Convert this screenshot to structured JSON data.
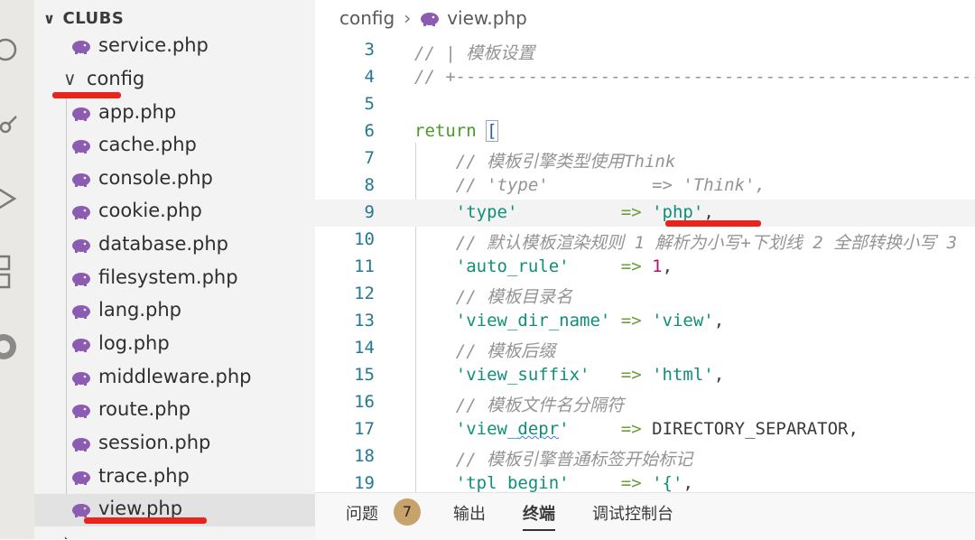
{
  "sidebar": {
    "header": "CLUBS",
    "items": [
      {
        "type": "file",
        "name": "service.php"
      },
      {
        "type": "folder",
        "name": "config"
      },
      {
        "type": "file",
        "name": "app.php"
      },
      {
        "type": "file",
        "name": "cache.php"
      },
      {
        "type": "file",
        "name": "console.php"
      },
      {
        "type": "file",
        "name": "cookie.php"
      },
      {
        "type": "file",
        "name": "database.php"
      },
      {
        "type": "file",
        "name": "filesystem.php"
      },
      {
        "type": "file",
        "name": "lang.php"
      },
      {
        "type": "file",
        "name": "log.php"
      },
      {
        "type": "file",
        "name": "middleware.php"
      },
      {
        "type": "file",
        "name": "route.php"
      },
      {
        "type": "file",
        "name": "session.php"
      },
      {
        "type": "file",
        "name": "trace.php"
      },
      {
        "type": "file",
        "name": "view.php",
        "selected": true
      }
    ]
  },
  "breadcrumb": {
    "folder": "config",
    "file": "view.php"
  },
  "code": {
    "lines": [
      {
        "n": "3",
        "tokens": [
          {
            "c": "comment",
            "t": "// | 模板设置"
          }
        ]
      },
      {
        "n": "4",
        "tokens": [
          {
            "c": "comment",
            "t": "// +-------------------------------------------------------"
          }
        ]
      },
      {
        "n": "5",
        "tokens": []
      },
      {
        "n": "6",
        "tokens": [
          {
            "c": "kw",
            "t": "return "
          },
          {
            "c": "brk",
            "t": "["
          }
        ]
      },
      {
        "n": "7",
        "tokens": [
          {
            "c": "comment",
            "t": "    // 模板引擎类型使用Think"
          }
        ]
      },
      {
        "n": "8",
        "tokens": [
          {
            "c": "comment",
            "t": "    // 'type'          => 'Think',"
          }
        ]
      },
      {
        "n": "9",
        "tokens": [
          {
            "c": "str",
            "t": "    'type'"
          },
          {
            "c": "op",
            "t": "          => "
          },
          {
            "c": "str",
            "t": "'php'"
          },
          {
            "c": "const",
            "t": ","
          }
        ]
      },
      {
        "n": "10",
        "tokens": [
          {
            "c": "comment",
            "t": "    // 默认模板渲染规则 1 解析为小写+下划线 2 全部转换小写 3"
          }
        ]
      },
      {
        "n": "11",
        "tokens": [
          {
            "c": "str",
            "t": "    'auto_rule'"
          },
          {
            "c": "op",
            "t": "     => "
          },
          {
            "c": "num",
            "t": "1"
          },
          {
            "c": "const",
            "t": ","
          }
        ]
      },
      {
        "n": "12",
        "tokens": [
          {
            "c": "comment",
            "t": "    // 模板目录名"
          }
        ]
      },
      {
        "n": "13",
        "tokens": [
          {
            "c": "str",
            "t": "    'view_dir_name'"
          },
          {
            "c": "op",
            "t": " => "
          },
          {
            "c": "str",
            "t": "'view'"
          },
          {
            "c": "const",
            "t": ","
          }
        ]
      },
      {
        "n": "14",
        "tokens": [
          {
            "c": "comment",
            "t": "    // 模板后缀"
          }
        ]
      },
      {
        "n": "15",
        "tokens": [
          {
            "c": "str",
            "t": "    'view_suffix'"
          },
          {
            "c": "op",
            "t": "   => "
          },
          {
            "c": "str",
            "t": "'html'"
          },
          {
            "c": "const",
            "t": ","
          }
        ]
      },
      {
        "n": "16",
        "tokens": [
          {
            "c": "comment",
            "t": "    // 模板文件名分隔符"
          }
        ]
      },
      {
        "n": "17",
        "tokens": [
          {
            "c": "str",
            "t": "    'view_depr'"
          },
          {
            "c": "op",
            "t": "     => "
          },
          {
            "c": "const",
            "t": "DIRECTORY_SEPARATOR,"
          }
        ]
      },
      {
        "n": "18",
        "tokens": [
          {
            "c": "comment",
            "t": "    // 模板引擎普通标签开始标记"
          }
        ]
      },
      {
        "n": "19",
        "tokens": [
          {
            "c": "str",
            "t": "    'tpl_begin'"
          },
          {
            "c": "op",
            "t": "     => "
          },
          {
            "c": "str",
            "t": "'{'"
          },
          {
            "c": "const",
            "t": ","
          }
        ]
      }
    ]
  },
  "panel": {
    "tabs": [
      {
        "label": "问题",
        "badge": "7"
      },
      {
        "label": "输出"
      },
      {
        "label": "终端",
        "active": true
      },
      {
        "label": "调试控制台"
      }
    ]
  },
  "colors": {
    "annotation_red": "#e8241b",
    "php_icon": "#8c5bb2"
  }
}
